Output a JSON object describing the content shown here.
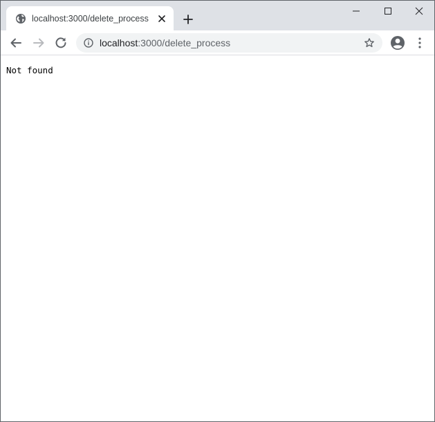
{
  "browser": {
    "tab": {
      "title": "localhost:3000/delete_process",
      "favicon": "globe-icon"
    },
    "address_bar": {
      "host": "localhost",
      "path": ":3000/delete_process"
    },
    "icons": {
      "back": "arrow-left-icon",
      "forward": "arrow-right-icon",
      "reload": "reload-icon",
      "info": "info-icon",
      "bookmark": "star-icon",
      "profile": "account-icon",
      "menu": "vertical-dots-icon",
      "new_tab": "plus-icon",
      "minimize": "minimize-icon",
      "maximize": "maximize-icon",
      "close": "close-icon"
    },
    "colors": {
      "tabstrip": "#dee1e6",
      "omnibox": "#f1f3f4",
      "icon": "#5f6368"
    }
  },
  "page": {
    "body_text": "Not found"
  }
}
